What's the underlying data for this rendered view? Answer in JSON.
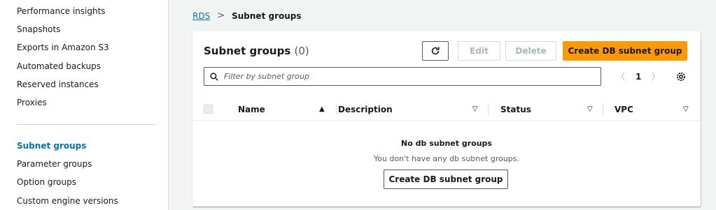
{
  "sidebar": {
    "items": [
      {
        "label": "Performance insights"
      },
      {
        "label": "Snapshots"
      },
      {
        "label": "Exports in Amazon S3"
      },
      {
        "label": "Automated backups"
      },
      {
        "label": "Reserved instances"
      },
      {
        "label": "Proxies"
      },
      {
        "label": "Subnet groups",
        "active": true
      },
      {
        "label": "Parameter groups"
      },
      {
        "label": "Option groups"
      },
      {
        "label": "Custom engine versions"
      }
    ]
  },
  "breadcrumb": {
    "root": "RDS",
    "separator": ">",
    "current": "Subnet groups"
  },
  "panel": {
    "title": "Subnet groups",
    "count": "(0)",
    "buttons": {
      "edit": "Edit",
      "delete": "Delete",
      "create": "Create DB subnet group"
    },
    "filter": {
      "placeholder": "Filter by subnet group"
    },
    "pager": {
      "prev": "〈",
      "page": "1",
      "next": "〉"
    },
    "columns": [
      {
        "label": "Name",
        "sort": "▲"
      },
      {
        "label": "Description",
        "sort": "▽"
      },
      {
        "label": "Status",
        "sort": "▽"
      },
      {
        "label": "VPC",
        "sort": "▽"
      }
    ],
    "empty": {
      "title": "No db subnet groups",
      "description": "You don't have any db subnet groups.",
      "button": "Create DB subnet group"
    }
  },
  "colors": {
    "accent": "#0073bb",
    "primary_button": "#ff9900"
  },
  "icons": [
    "refresh-icon",
    "search-icon",
    "chevron-left-icon",
    "chevron-right-icon",
    "settings-icon"
  ]
}
